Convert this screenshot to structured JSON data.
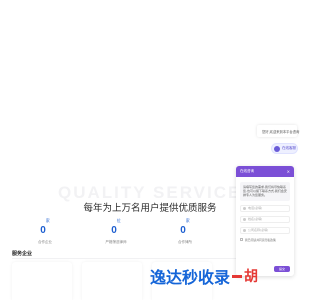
{
  "hero": {
    "background_word": "QUALITY SERVICE",
    "headline": "每年为上万名用户提供优质服务"
  },
  "stats": [
    {
      "value": "0",
      "unit": "家",
      "label": "合作企业"
    },
    {
      "value": "0",
      "unit": "位",
      "label": "严格筛选律师"
    },
    {
      "value": "0",
      "unit": "家",
      "label": "合作律所"
    }
  ],
  "services": {
    "title": "服务企业"
  },
  "floating": {
    "card_text": "您好,欢迎来到本平台咨询",
    "online_label": "在线客服"
  },
  "chat": {
    "title": "在线咨询",
    "close_glyph": "×",
    "message": "请填写您的需求,我们将尽快联系您,也可以留下联系方式,我们会安排专人为您服务。",
    "fields": [
      "电话(必填)",
      "姓名(必填)",
      "公司名称(必填)"
    ],
    "agree_text": "我已阅读并同意隐私政策",
    "submit_label": "提交"
  },
  "watermark": {
    "text": "逸达秒收录",
    "suffix": "胡"
  },
  "colors": {
    "accent": "#1e5fd0",
    "chat_header": "#7b4fd6",
    "watermark_blue": "#1565d8",
    "watermark_red": "#e53935"
  }
}
